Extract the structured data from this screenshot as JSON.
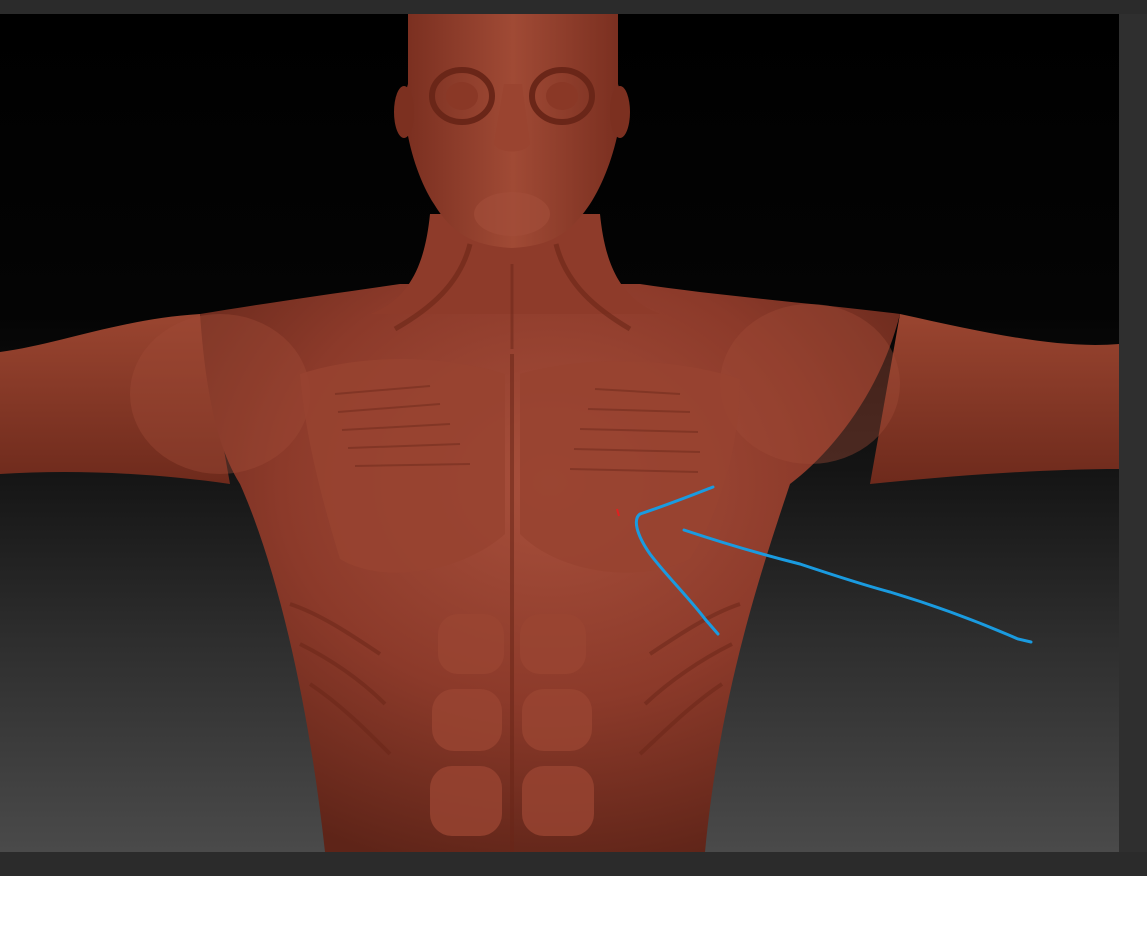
{
  "app": {
    "viewport": {
      "subject": "sculpted-male-torso-model",
      "material_color": "#8c3a2a",
      "background_top": "#000000",
      "background_bottom": "#4a4a4a"
    },
    "annotation": {
      "stroke_color": "#1a9be0",
      "marker_color": "#e02020"
    },
    "chrome_color": "#2b2b2b"
  }
}
